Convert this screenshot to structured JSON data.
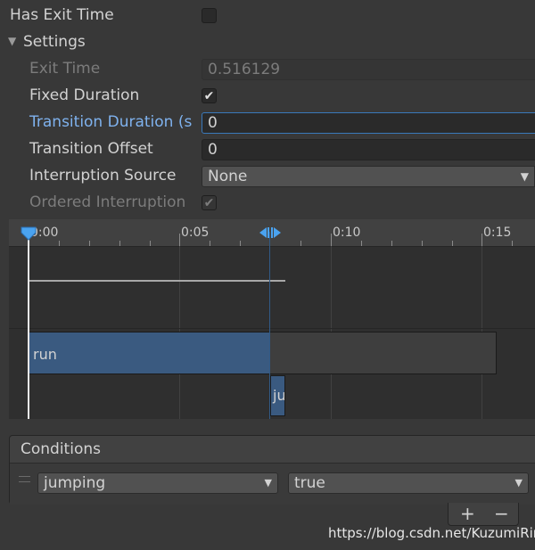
{
  "has_exit_time": {
    "label": "Has Exit Time",
    "checked": false
  },
  "settings": {
    "label": "Settings",
    "exit_time": {
      "label": "Exit Time",
      "value": "0.516129"
    },
    "fixed_duration": {
      "label": "Fixed Duration",
      "checked": true
    },
    "transition_duration": {
      "label": "Transition Duration (s",
      "value": "0"
    },
    "transition_offset": {
      "label": "Transition Offset",
      "value": "0"
    },
    "interruption_source": {
      "label": "Interruption Source",
      "value": "None"
    },
    "ordered_interruption": {
      "label": "Ordered Interruption",
      "checked": true
    }
  },
  "timeline": {
    "ticks": [
      "0:00",
      "0:05",
      "0:10",
      "0:15"
    ],
    "clip_run": "run",
    "clip_jump": "ju"
  },
  "conditions": {
    "header": "Conditions",
    "rows": [
      {
        "parameter": "jumping",
        "value": "true"
      }
    ],
    "add_label": "+",
    "remove_label": "−"
  },
  "watermark": "https://blog.csdn.net/KuzumiRin",
  "colors": {
    "focus_blue": "#7fb2ee",
    "clip_blue": "#3a5a80",
    "marker_blue": "#4aa3f0"
  }
}
